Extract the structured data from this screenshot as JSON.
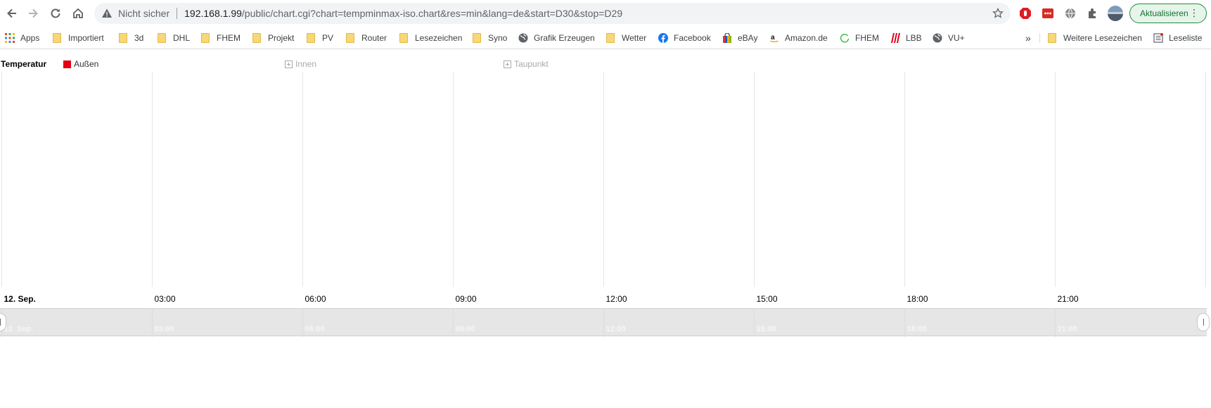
{
  "browser": {
    "address": {
      "security_label": "Nicht sicher",
      "host": "192.168.1.99",
      "path": "/public/chart.cgi?chart=tempminmax-iso.chart&res=min&lang=de&start=D30&stop=D29"
    },
    "update_button": "Aktualisieren",
    "bookmarks": [
      {
        "label": "Apps",
        "icon": "apps-grid-icon"
      },
      {
        "label": "Importiert",
        "icon": "folder-icon"
      },
      {
        "label": "3d",
        "icon": "folder-icon"
      },
      {
        "label": "DHL",
        "icon": "folder-icon"
      },
      {
        "label": "FHEM",
        "icon": "folder-icon"
      },
      {
        "label": "Projekt",
        "icon": "folder-icon"
      },
      {
        "label": "PV",
        "icon": "folder-icon"
      },
      {
        "label": "Router",
        "icon": "folder-icon"
      },
      {
        "label": "Lesezeichen",
        "icon": "folder-icon"
      },
      {
        "label": "Syno",
        "icon": "folder-icon"
      },
      {
        "label": "Grafik Erzeugen",
        "icon": "globe-icon"
      },
      {
        "label": "Wetter",
        "icon": "folder-icon"
      },
      {
        "label": "Facebook",
        "icon": "facebook-icon"
      },
      {
        "label": "eBAy",
        "icon": "ebay-bag-icon"
      },
      {
        "label": "Amazon.de",
        "icon": "amazon-icon"
      },
      {
        "label": "FHEM",
        "icon": "fhem-icon"
      },
      {
        "label": "LBB",
        "icon": "lbb-icon"
      },
      {
        "label": "VU+",
        "icon": "globe-icon"
      }
    ],
    "more_bookmarks": "»",
    "other_bookmarks": "Weitere Lesezeichen",
    "reading_list": "Leseliste"
  },
  "chart": {
    "legend_title": "Temperatur",
    "series": [
      {
        "name": "Außen",
        "color": "#e3000f",
        "visible": true
      },
      {
        "name": "Innen",
        "color": "#aaaaaa",
        "visible": false
      },
      {
        "name": "Taupunkt",
        "color": "#aaaaaa",
        "visible": false
      }
    ],
    "x_ticks": [
      "12. Sep.",
      "03:00",
      "06:00",
      "09:00",
      "12:00",
      "15:00",
      "18:00",
      "21:00"
    ],
    "navigator_ticks": [
      "12. Sep.",
      "03:00",
      "06:00",
      "09:00",
      "12:00",
      "15:00",
      "18:00",
      "21:00"
    ]
  },
  "chart_data": {
    "type": "line",
    "title": "",
    "x": [
      "12. Sep.",
      "03:00",
      "06:00",
      "09:00",
      "12:00",
      "15:00",
      "18:00",
      "21:00"
    ],
    "series": [
      {
        "name": "Außen",
        "values": []
      },
      {
        "name": "Innen",
        "values": []
      },
      {
        "name": "Taupunkt",
        "values": []
      }
    ],
    "grid": true,
    "legend": "top-left"
  }
}
